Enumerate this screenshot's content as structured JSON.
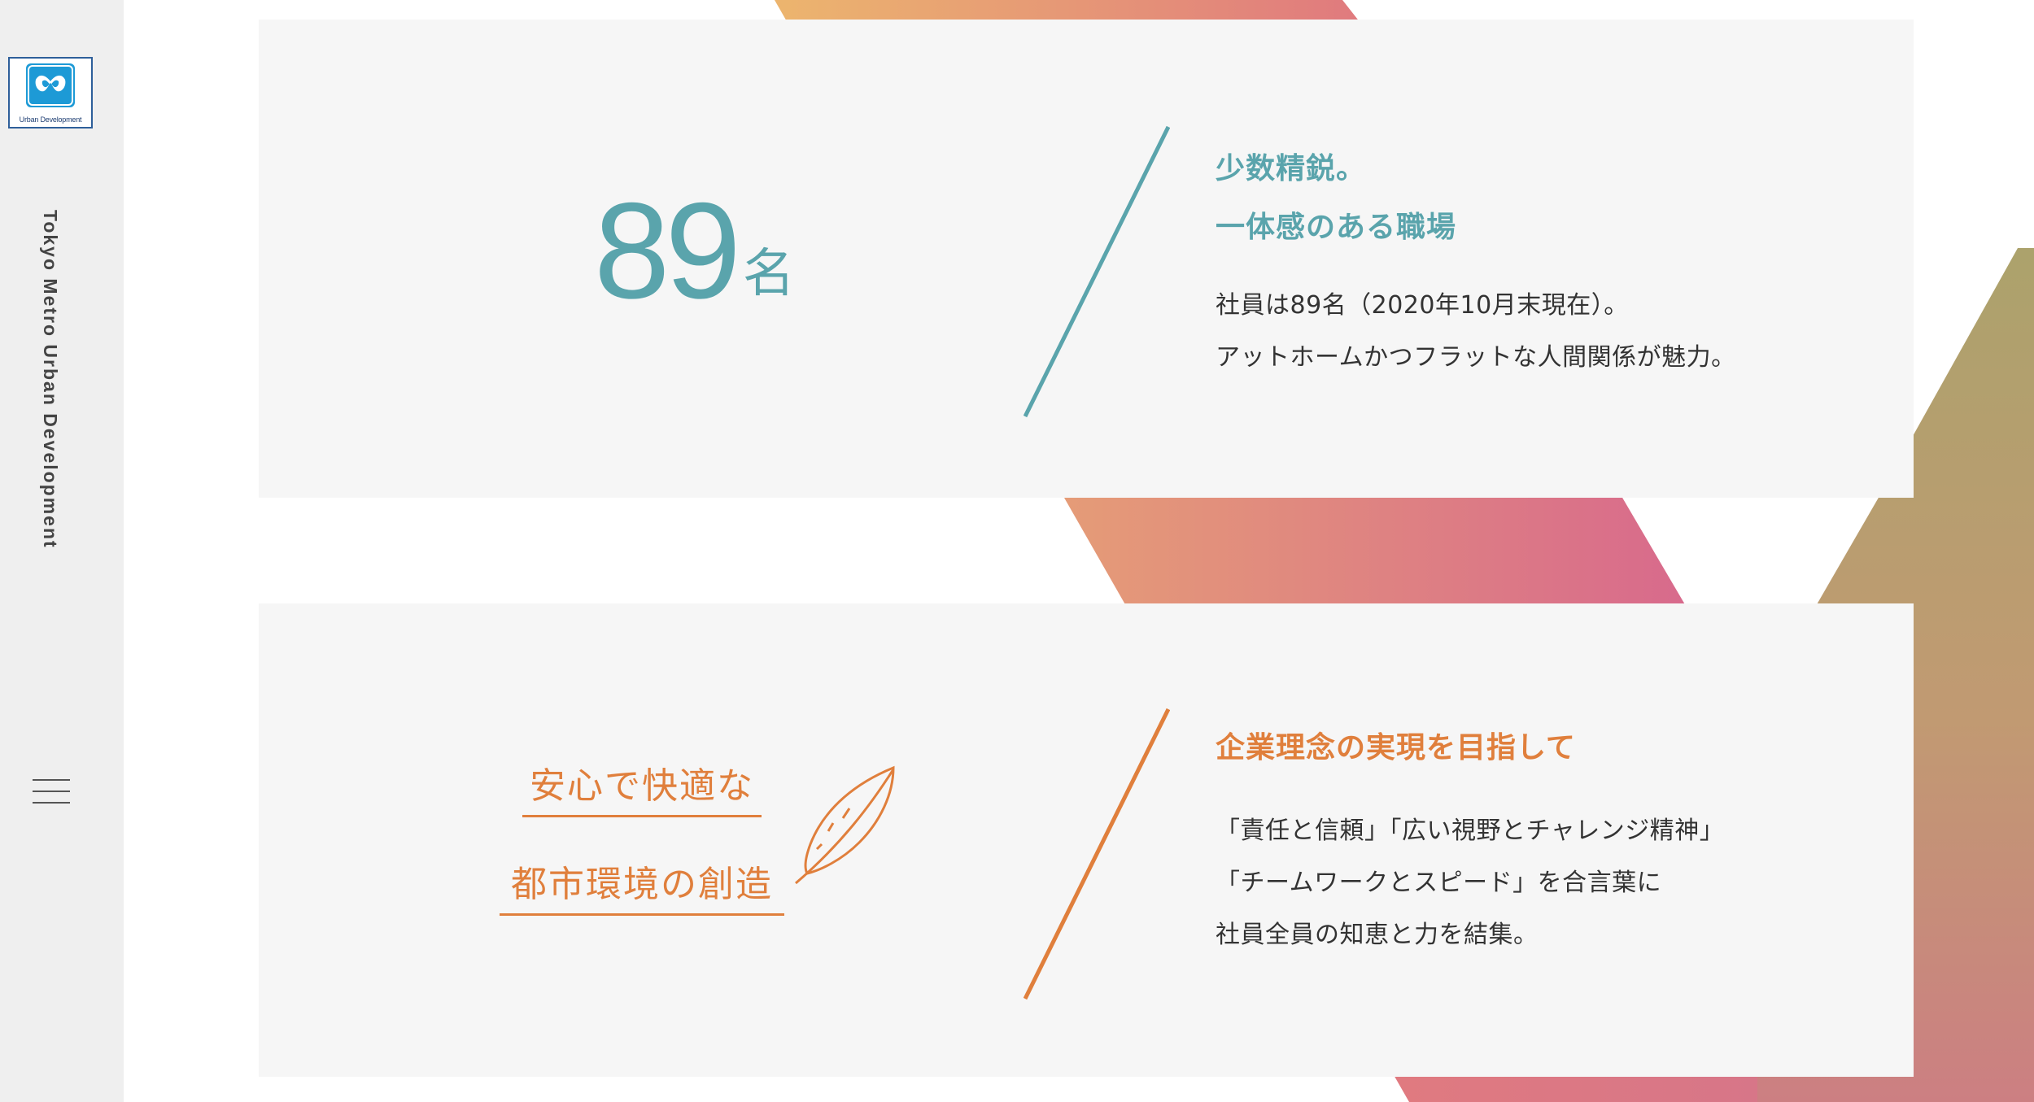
{
  "sidebar": {
    "logo_caption": "Urban Development",
    "vertical_title": "Tokyo Metro Urban Development",
    "menu_icon": "hamburger-menu-icon"
  },
  "stat_card": {
    "number": "89",
    "unit": "名",
    "heading_lines": [
      "少数精鋭。",
      "一体感のある職場"
    ],
    "body_lines": [
      "社員は89名（2020年10月末現在）。",
      "アットホームかつフラットな人間関係が魅力。"
    ],
    "accent_color": "#5aa4ac"
  },
  "philosophy_card": {
    "motto_lines": [
      "安心で快適な",
      "都市環境の創造"
    ],
    "motto_icon": "feather-icon",
    "heading": "企業理念の実現を目指して",
    "body_lines": [
      "「責任と信頼」「広い視野とチャレンジ精神」",
      "「チームワークとスピード」を合言葉に",
      "社員全員の知恵と力を結集。"
    ],
    "accent_color": "#e07f3c"
  }
}
